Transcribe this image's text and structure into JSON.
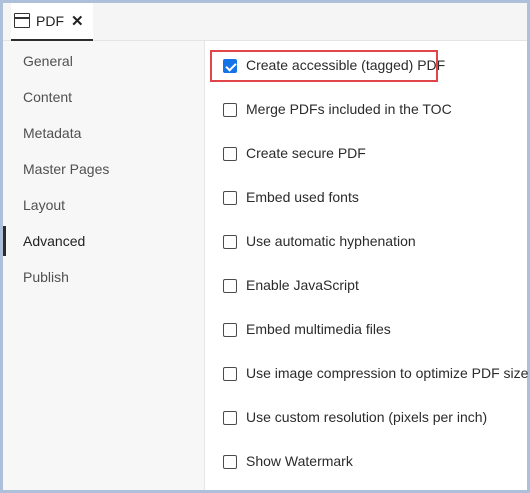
{
  "tab": {
    "label": "PDF",
    "close": "✕"
  },
  "sidebar": {
    "items": [
      {
        "label": "General"
      },
      {
        "label": "Content"
      },
      {
        "label": "Metadata"
      },
      {
        "label": "Master Pages"
      },
      {
        "label": "Layout"
      },
      {
        "label": "Advanced",
        "active": true
      },
      {
        "label": "Publish"
      }
    ]
  },
  "options": [
    {
      "label": "Create accessible (tagged) PDF",
      "checked": true,
      "highlighted": true
    },
    {
      "label": "Merge PDFs included in the TOC",
      "checked": false
    },
    {
      "label": "Create secure PDF",
      "checked": false
    },
    {
      "label": "Embed used fonts",
      "checked": false
    },
    {
      "label": "Use automatic hyphenation",
      "checked": false
    },
    {
      "label": "Enable JavaScript",
      "checked": false
    },
    {
      "label": "Embed multimedia files",
      "checked": false
    },
    {
      "label": "Use image compression to optimize PDF size",
      "checked": false
    },
    {
      "label": "Use custom resolution (pixels per inch)",
      "checked": false
    },
    {
      "label": "Show Watermark",
      "checked": false
    }
  ],
  "colors": {
    "accent": "#1473e6",
    "highlight": "#e0454a",
    "frame": "#aebfd9"
  }
}
